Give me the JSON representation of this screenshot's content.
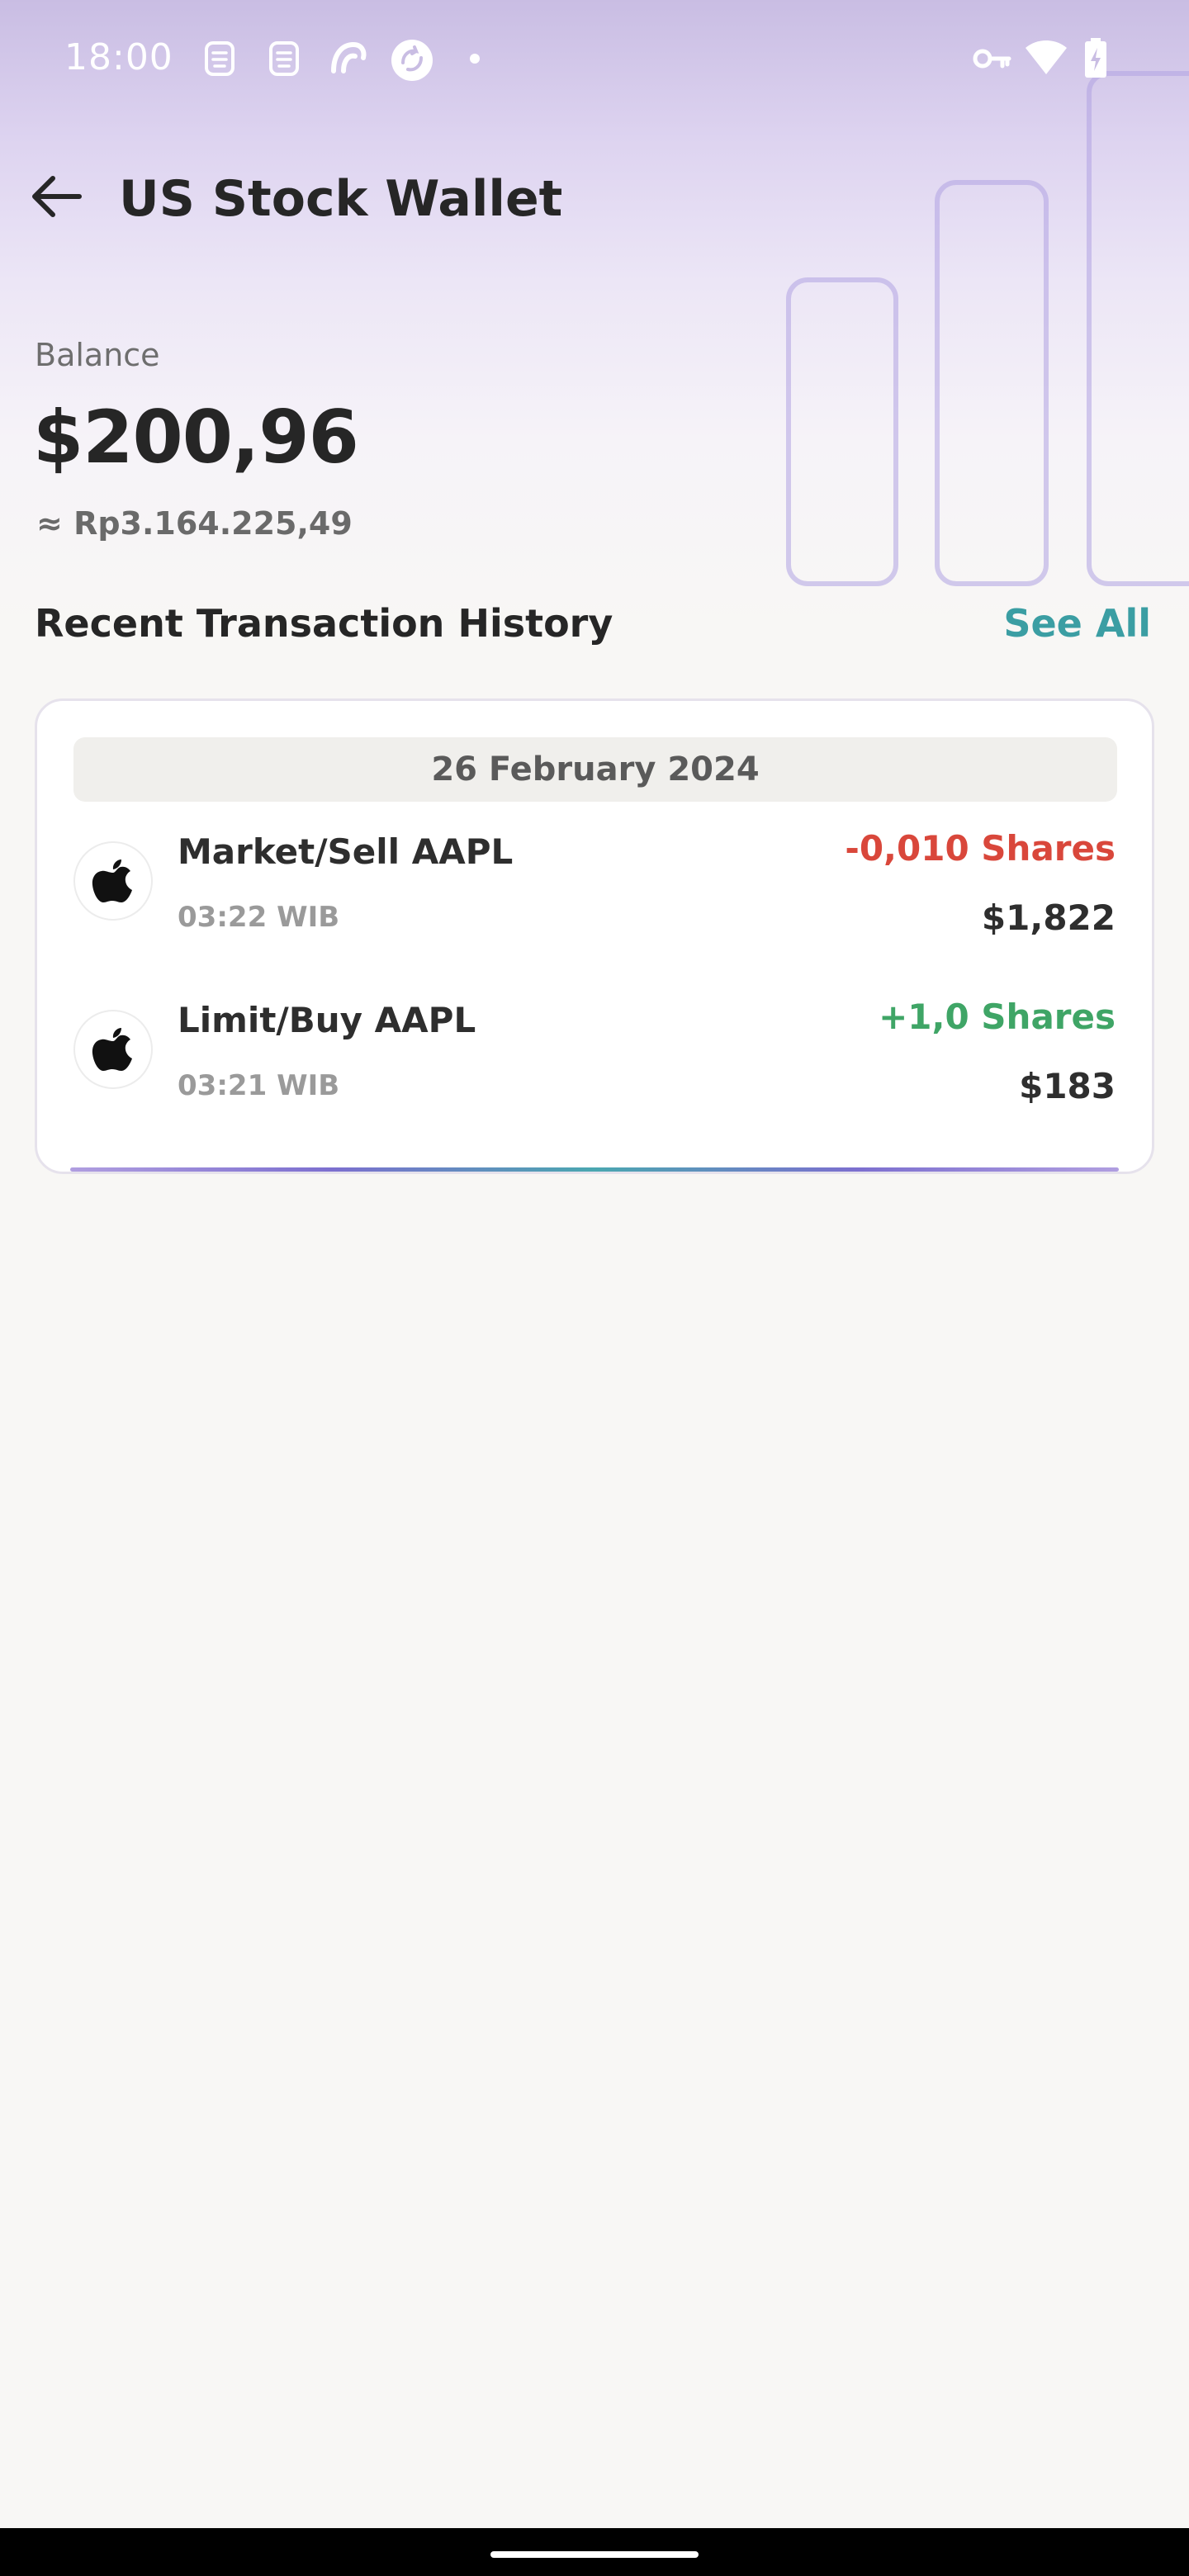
{
  "status_bar": {
    "time": "18:00",
    "icons": [
      "sim-icon",
      "sim-icon",
      "sync-app-icon",
      "refresh-app-icon",
      "dot-icon",
      "vpn-key-icon",
      "wifi-icon",
      "battery-charging-icon"
    ]
  },
  "header": {
    "title": "US Stock Wallet",
    "back_icon": "arrow-left-icon"
  },
  "balance": {
    "label": "Balance",
    "value": "$200,96",
    "idr_value": "≈ Rp3.164.225,49"
  },
  "transactions": {
    "section_title": "Recent Transaction History",
    "see_all_label": "See All",
    "date": "26 February 2024",
    "items": [
      {
        "logo": "apple-logo-icon",
        "title": "Market/Sell AAPL",
        "time": "03:22 WIB",
        "shares": "-0,010 Shares",
        "amount": "$1,822"
      },
      {
        "logo": "apple-logo-icon",
        "title": "Limit/Buy AAPL",
        "time": "03:21 WIB",
        "shares": "+1,0 Shares",
        "amount": "$183"
      }
    ]
  },
  "colors": {
    "accent": "#3b9ea3",
    "negative": "#d9473b",
    "positive": "#3fa566",
    "hero_gradient_top": "#c9bde3"
  }
}
